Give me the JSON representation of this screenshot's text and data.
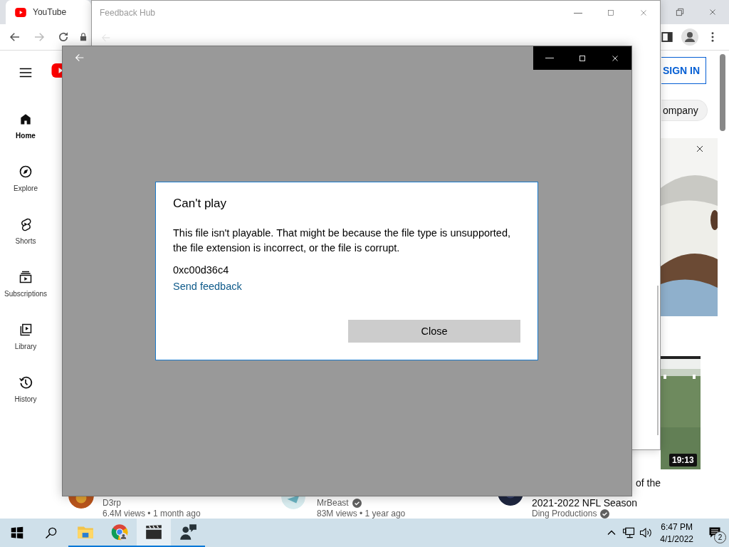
{
  "browser": {
    "tab_title": "YouTube",
    "sidebar": [
      {
        "kind": "home",
        "label": "Home",
        "selected": true
      },
      {
        "kind": "explore",
        "label": "Explore",
        "selected": false
      },
      {
        "kind": "shorts",
        "label": "Shorts",
        "selected": false
      },
      {
        "kind": "subscriptions",
        "label": "Subscriptions",
        "selected": false
      },
      {
        "kind": "library",
        "label": "Library",
        "selected": false
      },
      {
        "kind": "history",
        "label": "History",
        "selected": false
      }
    ],
    "sign_in": "SIGN IN",
    "chip": "ompany",
    "duration": "19:13",
    "videos": [
      {
        "channel": "D3rp",
        "verified": false,
        "meta": "6.4M views • 1 month ago"
      },
      {
        "channel": "MrBeast",
        "verified": true,
        "meta": "83M views • 1 year ago"
      },
      {
        "title_fragment": "of the",
        "title": "2021-2022 NFL Season",
        "channel": "Ding Productions",
        "verified": true
      }
    ]
  },
  "feedback_hub": {
    "title": "Feedback Hub"
  },
  "dialog": {
    "title": "Can't play",
    "message": "This file isn't playable. That might be because the file type is unsupported, the file extension is incorrect, or the file is corrupt.",
    "error_code": "0xc00d36c4",
    "link": "Send feedback",
    "button": "Close"
  },
  "taskbar": {
    "apps": [
      {
        "kind": "files",
        "selected": false
      },
      {
        "kind": "chrome",
        "selected": false
      },
      {
        "kind": "movies",
        "selected": true
      },
      {
        "kind": "feedback",
        "selected": false
      }
    ],
    "time": "6:47 PM",
    "date": "4/1/2022",
    "notification_count": "2"
  }
}
